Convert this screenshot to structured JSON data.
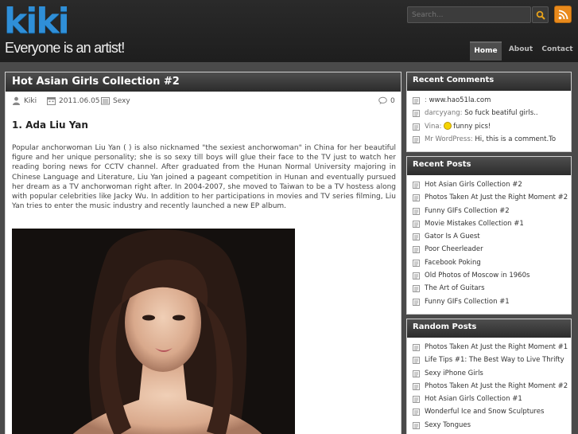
{
  "site": {
    "logo": "kiki",
    "tagline": "Everyone is an artist!",
    "colors": {
      "logo": "#2f8fd8",
      "rss": "#e98a1c",
      "title_bar": "#3a3a3a"
    }
  },
  "search": {
    "placeholder": "Search..."
  },
  "nav": [
    {
      "label": "Home",
      "active": true
    },
    {
      "label": "About",
      "active": false
    },
    {
      "label": "Contact",
      "active": false
    }
  ],
  "post": {
    "title": "Hot Asian Girls Collection #2",
    "author": "Kiki",
    "date": "2011.06.05",
    "category": "Sexy",
    "comments": "0",
    "section_heading": "1. Ada Liu Yan",
    "body": "Popular anchorwoman Liu Yan (   ) is also nicknamed \"the sexiest anchorwoman\" in China for her beautiful figure and her unique personality; she is so sexy till boys will glue their face to the TV just to watch her reading boring news for CCTV channel. After graduated from the Hunan Normal University majoring in Chinese Language and Literature, Liu Yan joined a pageant competition in Hunan and eventually pursued her dream as a TV anchorwoman right after. In 2004-2007, she moved to Taiwan to be a TV hostess along with popular celebrities like Jacky Wu. In addition to her participations in movies and TV series filming, Liu Yan tries to enter the music industry and recently launched a new EP album."
  },
  "sidebar": {
    "recent_comments": {
      "title": "Recent Comments",
      "items": [
        {
          "author": "",
          "sep": " : ",
          "text": "www.hao51la.com"
        },
        {
          "author": "darcyyang",
          "sep": ": ",
          "text": "So fuck beatiful girls.."
        },
        {
          "author": "Vina",
          "sep": ": ",
          "text": "funny pics!"
        },
        {
          "author": "Mr WordPress",
          "sep": ": ",
          "text": "Hi, this is a comment.To"
        }
      ]
    },
    "recent_posts": {
      "title": "Recent Posts",
      "items": [
        "Hot Asian Girls Collection #2",
        "Photos Taken At Just the Right Moment #2",
        "Funny GIFs Collection #2",
        "Movie Mistakes Collection #1",
        "Gator Is A Guest",
        "Poor Cheerleader",
        "Facebook Poking",
        "Old Photos of Moscow in 1960s",
        "The Art of Guitars",
        "Funny GIFs Collection #1"
      ]
    },
    "random_posts": {
      "title": "Random Posts",
      "items": [
        "Photos Taken At Just the Right Moment #1",
        "Life Tips #1: The Best Way to Live Thrifty",
        "Sexy iPhone Girls",
        "Photos Taken At Just the Right Moment #2",
        "Hot Asian Girls Collection #1",
        "Wonderful Ice and Snow Sculptures",
        "Sexy Tongues"
      ]
    }
  }
}
